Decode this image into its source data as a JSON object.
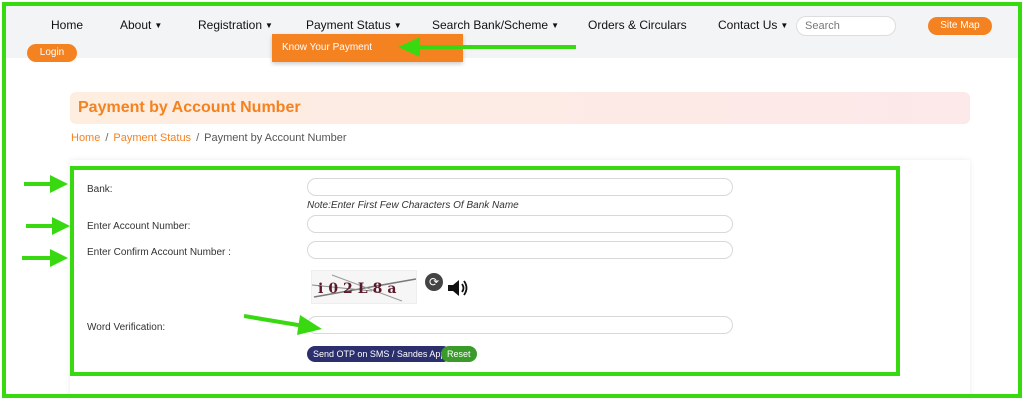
{
  "nav": {
    "items": [
      {
        "label": "Home"
      },
      {
        "label": "About"
      },
      {
        "label": "Registration"
      },
      {
        "label": "Payment Status"
      },
      {
        "label": "Search Bank/Scheme"
      },
      {
        "label": "Orders & Circulars"
      },
      {
        "label": "Contact Us"
      }
    ],
    "search_placeholder": "Search",
    "sitemap_label": "Site Map",
    "login_label": "Login"
  },
  "dropdown": {
    "item": "Know Your Payment"
  },
  "page": {
    "title": "Payment by Account Number"
  },
  "breadcrumb": {
    "home": "Home",
    "section": "Payment Status",
    "current": "Payment by Account Number",
    "separator": "/"
  },
  "form": {
    "bank_label": "Bank:",
    "bank_note": "Note:Enter First Few Characters Of Bank Name",
    "account_label": "Enter Account Number:",
    "confirm_label": "Enter Confirm Account Number :",
    "word_label": "Word Verification:",
    "captcha_text": "i02L8a",
    "send_otp_label": "Send OTP on SMS / Sandes App",
    "reset_label": "Reset"
  },
  "colors": {
    "accent": "#f58220",
    "annotation": "#39d911",
    "otp_button": "#2c2f6d",
    "reset_button": "#3a9b2a"
  },
  "icons": {
    "refresh": "refresh-icon",
    "speaker": "speaker-icon",
    "caret": "chevron-down-icon"
  }
}
